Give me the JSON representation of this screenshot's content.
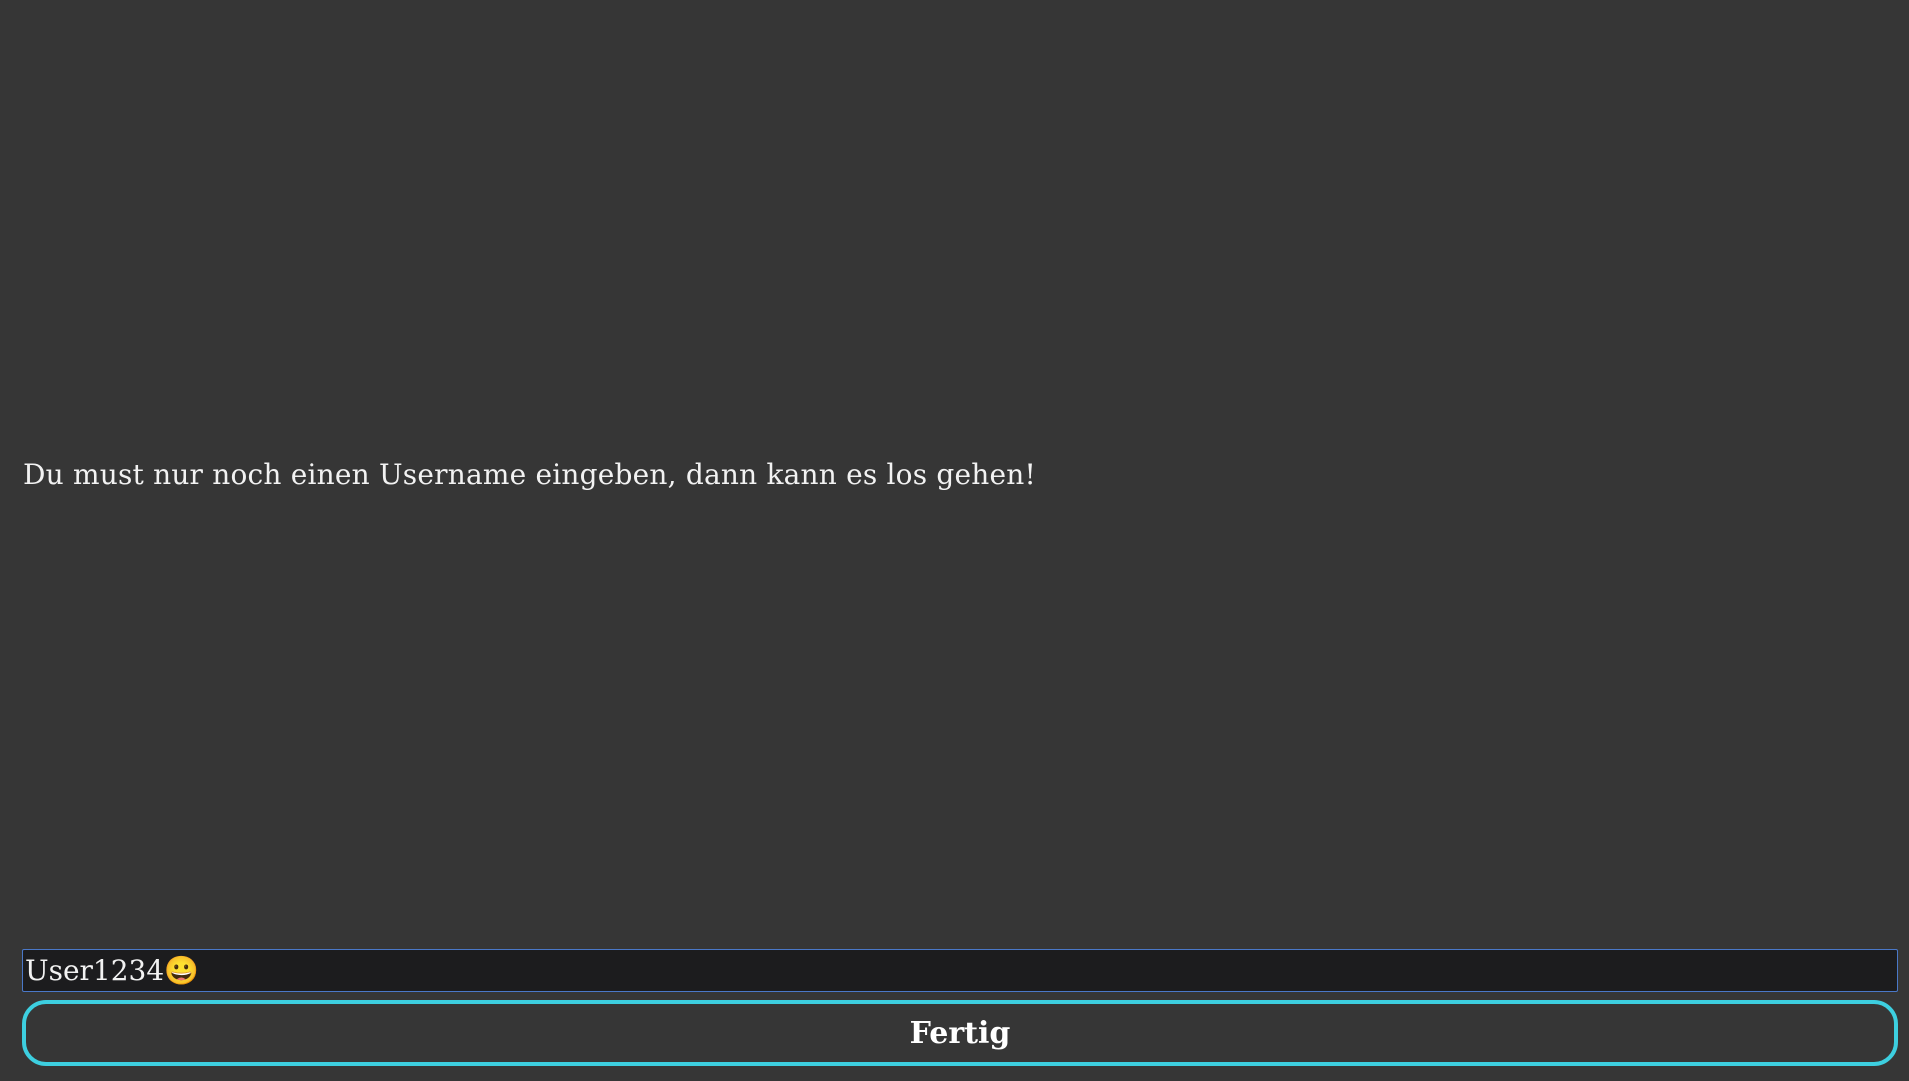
{
  "prompt": {
    "message": "Du must nur noch einen Username eingeben, dann kann es los gehen!"
  },
  "username_field": {
    "value": "User1234😀"
  },
  "done_button": {
    "label": "Fertig"
  },
  "colors": {
    "background": "#363636",
    "input_background": "#1c1c1e",
    "input_border": "#4a78c8",
    "button_border": "#3dcfe0",
    "text": "#f2f2f2"
  }
}
